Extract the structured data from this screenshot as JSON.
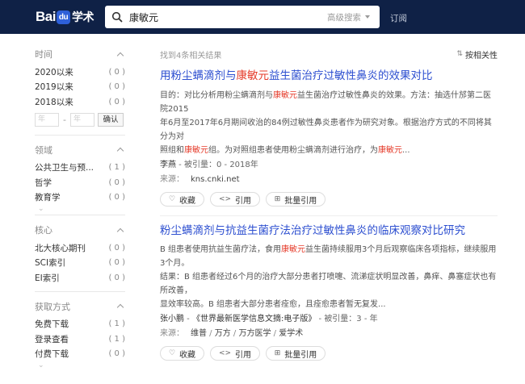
{
  "header": {
    "logo_prefix": "Bai",
    "logo_paw": "du",
    "logo_suffix": "学术",
    "search_query": "康敏元",
    "advanced_label": "高级搜索",
    "subscribe_label": "订阅",
    "search_icon": "search-icon"
  },
  "sidebar": {
    "time": {
      "label": "时间",
      "items": [
        {
          "label": "2020以来",
          "count": "( 0 )"
        },
        {
          "label": "2019以来",
          "count": "( 0 )"
        },
        {
          "label": "2018以来",
          "count": "( 0 )"
        }
      ],
      "from_placeholder": "年",
      "to_placeholder": "年",
      "confirm_label": "确认"
    },
    "field": {
      "label": "领域",
      "items": [
        {
          "label": "公共卫生与预...",
          "count": "( 1 )"
        },
        {
          "label": "哲学",
          "count": "( 0 )"
        },
        {
          "label": "教育学",
          "count": "( 0 )"
        }
      ]
    },
    "core": {
      "label": "核心",
      "items": [
        {
          "label": "北大核心期刊",
          "count": "( 0 )"
        },
        {
          "label": "SCI索引",
          "count": "( 0 )"
        },
        {
          "label": "EI索引",
          "count": "( 0 )"
        }
      ]
    },
    "access": {
      "label": "获取方式",
      "items": [
        {
          "label": "免费下载",
          "count": "( 1 )"
        },
        {
          "label": "登录查看",
          "count": "( 1 )"
        },
        {
          "label": "付费下载",
          "count": "( 0 )"
        }
      ]
    }
  },
  "results": {
    "found_text": "找到4条相关结果",
    "sort_label": "按相关性",
    "items": [
      {
        "title_pre": "用粉尘螨滴剂与",
        "title_hl": "康敏元",
        "title_post": "益生菌治疗过敏性鼻炎的效果对比",
        "abs1_pre": "目的：对比分析用粉尘螨滴剂与",
        "abs1_hl": "康敏元",
        "abs1_post": "益生菌治疗过敏性鼻炎的效果。方法：抽选什邡第二医院2015",
        "abs2": "年6月至2017年6月期间收治的84例过敏性鼻炎患者作为研究对象。根据治疗方式的不同将其分为对",
        "abs3_pre": "照组和",
        "abs3_hl": "康敏元",
        "abs3_mid": "组。为对照组患者使用粉尘螨滴剂进行治疗，为",
        "abs3_hl2": "康敏元",
        "abs3_post": "...",
        "author": "李燕",
        "cited": "被引量：0",
        "year": "2018年",
        "source_label": "来源：",
        "source": "kns.cnki.net",
        "actions": [
          "收藏",
          "引用",
          "批量引用"
        ]
      },
      {
        "title_pre": "粉尘螨滴剂与抗益生菌疗法治疗过敏性鼻炎的临床观察对比研究",
        "abs1_pre": "B 组患者使用抗益生菌疗法，食用",
        "abs1_hl": "康敏元",
        "abs1_post": "益生菌持续服用3个月后观察临床各项指标，继续服用3个月。",
        "abs2": "结果：B 组患者经过6个月的治疗大部分患者打喷嚏、流涕症状明显改善，鼻痒、鼻塞症状也有所改善，",
        "abs3": "显效率较高。B 组患者大部分患者痊愈，且痊愈患者暂无复发...",
        "author": "张小鹏",
        "journal": "《世界最新医学信息文摘:电子版》",
        "cited": "被引量：3",
        "year": "年",
        "source_label": "来源：",
        "sources": [
          "维普",
          "万方",
          "万方医学",
          "爱学术"
        ],
        "actions": [
          "收藏",
          "引用",
          "批量引用"
        ]
      }
    ]
  }
}
